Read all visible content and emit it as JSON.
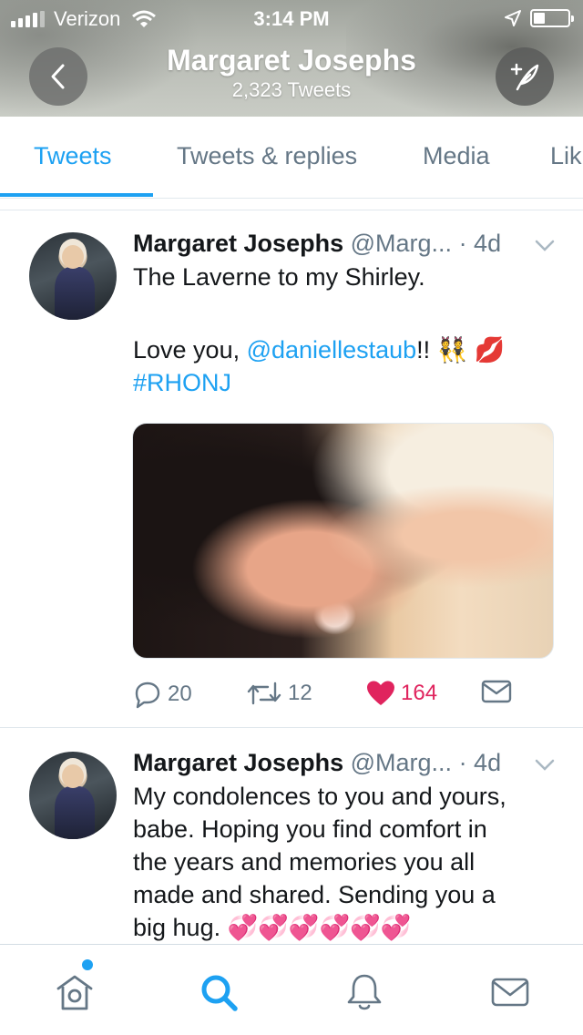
{
  "status_bar": {
    "carrier": "Verizon",
    "time": "3:14 PM"
  },
  "header": {
    "title": "Margaret Josephs",
    "tweet_count": "2,323 Tweets"
  },
  "tabs": [
    {
      "label": "Tweets",
      "active": true
    },
    {
      "label": "Tweets & replies",
      "active": false
    },
    {
      "label": "Media",
      "active": false
    },
    {
      "label": "Lik",
      "active": false
    }
  ],
  "tweets": [
    {
      "name": "Margaret Josephs",
      "handle": "@Marg...",
      "time": "· 4d",
      "line1": "The Laverne to my Shirley.",
      "line2_prefix": "Love you, ",
      "mention": "@daniellestaub",
      "line2_suffix": "!! 👯 💋",
      "hashtag": "#RHONJ",
      "replies": "20",
      "retweets": "12",
      "likes": "164"
    },
    {
      "name": "Margaret Josephs",
      "handle": "@Marg...",
      "time": "· 4d",
      "lines": [
        "My condolences to you and yours,",
        "babe. Hoping you find comfort in",
        "the years and memories you all",
        "made and shared. Sending you a",
        "big hug. 💞💞💞💞💞💞"
      ]
    }
  ],
  "colors": {
    "accent": "#1da1f2",
    "like": "#e0245e",
    "secondary_text": "#657786"
  },
  "bottom_nav": [
    "home-icon",
    "search-icon",
    "notifications-icon",
    "messages-icon"
  ]
}
